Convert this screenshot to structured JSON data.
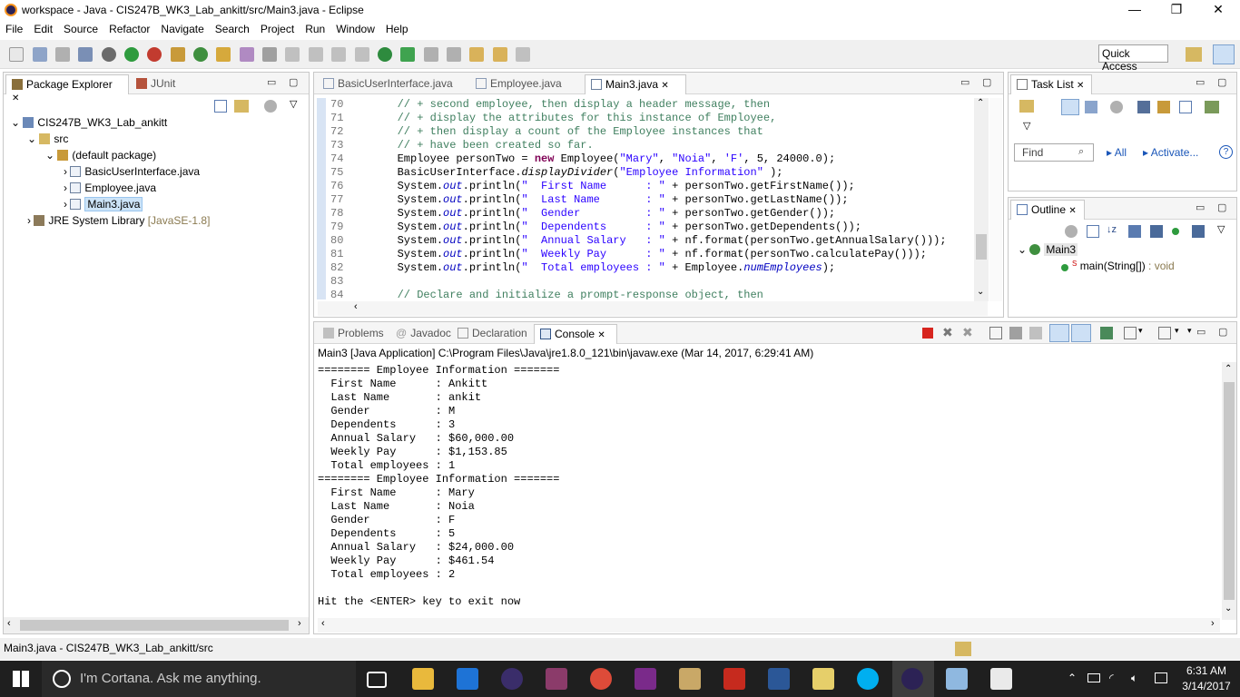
{
  "window": {
    "title": "workspace - Java - CIS247B_WK3_Lab_ankitt/src/Main3.java - Eclipse",
    "min": "—",
    "restore": "❐",
    "close": "✕"
  },
  "menu": [
    "File",
    "Edit",
    "Source",
    "Refactor",
    "Navigate",
    "Search",
    "Project",
    "Run",
    "Window",
    "Help"
  ],
  "toolbar": {
    "quick_access": "Quick Access"
  },
  "package_explorer": {
    "tabs": [
      "Package Explorer",
      "JUnit"
    ],
    "tree": [
      {
        "label": "CIS247B_WK3_Lab_ankitt"
      },
      {
        "label": "src"
      },
      {
        "label": "(default package)"
      },
      {
        "label": "BasicUserInterface.java"
      },
      {
        "label": "Employee.java"
      },
      {
        "label": "Main3.java"
      },
      {
        "label": "JRE System Library",
        "suffix": "[JavaSE-1.8]"
      }
    ]
  },
  "editor": {
    "tabs": [
      "BasicUserInterface.java",
      "Employee.java",
      "Main3.java"
    ],
    "lines": [
      {
        "n": "70",
        "parts": [
          [
            "cm",
            "        // + second employee, then display a header message, then"
          ]
        ]
      },
      {
        "n": "71",
        "parts": [
          [
            "cm",
            "        // + display the attributes for this instance of Employee,"
          ]
        ]
      },
      {
        "n": "72",
        "parts": [
          [
            "cm",
            "        // + then display a count of the Employee instances that"
          ]
        ]
      },
      {
        "n": "73",
        "parts": [
          [
            "cm",
            "        // + have been created so far."
          ]
        ]
      },
      {
        "n": "74",
        "parts": [
          [
            "",
            "        Employee personTwo = "
          ],
          [
            "kw",
            "new"
          ],
          [
            "",
            " Employee("
          ],
          [
            "st",
            "\"Mary\""
          ],
          [
            "",
            ", "
          ],
          [
            "st",
            "\"Noia\""
          ],
          [
            "",
            ", "
          ],
          [
            "st",
            "'F'"
          ],
          [
            "",
            ", 5, 24000.0);"
          ]
        ]
      },
      {
        "n": "75",
        "parts": [
          [
            "",
            "        BasicUserInterface."
          ],
          [
            "it",
            "displayDivider"
          ],
          [
            "",
            "("
          ],
          [
            "st",
            "\"Employee Information\""
          ],
          [
            "",
            " );"
          ]
        ]
      },
      {
        "n": "76",
        "parts": [
          [
            "",
            "        System."
          ],
          [
            "fd",
            "out"
          ],
          [
            "",
            ".println("
          ],
          [
            "st",
            "\"  First Name      : \""
          ],
          [
            "",
            " + personTwo.getFirstName());"
          ]
        ]
      },
      {
        "n": "77",
        "parts": [
          [
            "",
            "        System."
          ],
          [
            "fd",
            "out"
          ],
          [
            "",
            ".println("
          ],
          [
            "st",
            "\"  Last Name       : \""
          ],
          [
            "",
            " + personTwo.getLastName());"
          ]
        ]
      },
      {
        "n": "78",
        "parts": [
          [
            "",
            "        System."
          ],
          [
            "fd",
            "out"
          ],
          [
            "",
            ".println("
          ],
          [
            "st",
            "\"  Gender          : \""
          ],
          [
            "",
            " + personTwo.getGender());"
          ]
        ]
      },
      {
        "n": "79",
        "parts": [
          [
            "",
            "        System."
          ],
          [
            "fd",
            "out"
          ],
          [
            "",
            ".println("
          ],
          [
            "st",
            "\"  Dependents      : \""
          ],
          [
            "",
            " + personTwo.getDependents());"
          ]
        ]
      },
      {
        "n": "80",
        "parts": [
          [
            "",
            "        System."
          ],
          [
            "fd",
            "out"
          ],
          [
            "",
            ".println("
          ],
          [
            "st",
            "\"  Annual Salary   : \""
          ],
          [
            "",
            " + nf.format(personTwo.getAnnualSalary()));"
          ]
        ]
      },
      {
        "n": "81",
        "parts": [
          [
            "",
            "        System."
          ],
          [
            "fd",
            "out"
          ],
          [
            "",
            ".println("
          ],
          [
            "st",
            "\"  Weekly Pay      : \""
          ],
          [
            "",
            " + nf.format(personTwo.calculatePay()));"
          ]
        ]
      },
      {
        "n": "82",
        "parts": [
          [
            "",
            "        System."
          ],
          [
            "fd",
            "out"
          ],
          [
            "",
            ".println("
          ],
          [
            "st",
            "\"  Total employees : \""
          ],
          [
            "",
            " + Employee."
          ],
          [
            "fd",
            "numEmployees"
          ],
          [
            "",
            ");"
          ]
        ]
      },
      {
        "n": "83",
        "parts": [
          [
            "",
            ""
          ]
        ]
      },
      {
        "n": "84",
        "parts": [
          [
            "cm",
            "        // Declare and initialize a prompt-response object, then"
          ]
        ]
      }
    ]
  },
  "task_list": {
    "title": "Task List",
    "find": "Find",
    "all": "All",
    "activate": "Activate..."
  },
  "outline": {
    "title": "Outline",
    "class": "Main3",
    "method": "main(String[])",
    "method_type": " : void"
  },
  "console": {
    "tabs": [
      "Problems",
      "Javadoc",
      "Declaration",
      "Console"
    ],
    "header": "Main3 [Java Application] C:\\Program Files\\Java\\jre1.8.0_121\\bin\\javaw.exe (Mar 14, 2017, 6:29:41 AM)",
    "lines": [
      "======== Employee Information =======",
      "  First Name      : Ankitt",
      "  Last Name       : ankit",
      "  Gender          : M",
      "  Dependents      : 3",
      "  Annual Salary   : $60,000.00",
      "  Weekly Pay      : $1,153.85",
      "  Total employees : 1",
      "======== Employee Information =======",
      "  First Name      : Mary",
      "  Last Name       : Noia",
      "  Gender          : F",
      "  Dependents      : 5",
      "  Annual Salary   : $24,000.00",
      "  Weekly Pay      : $461.54",
      "  Total employees : 2",
      "",
      "Hit the <ENTER> key to exit now"
    ]
  },
  "status": {
    "path": "Main3.java - CIS247B_WK3_Lab_ankitt/src"
  },
  "taskbar": {
    "cortana": "I'm Cortana. Ask me anything.",
    "time": "6:31 AM",
    "date": "3/14/2017"
  }
}
